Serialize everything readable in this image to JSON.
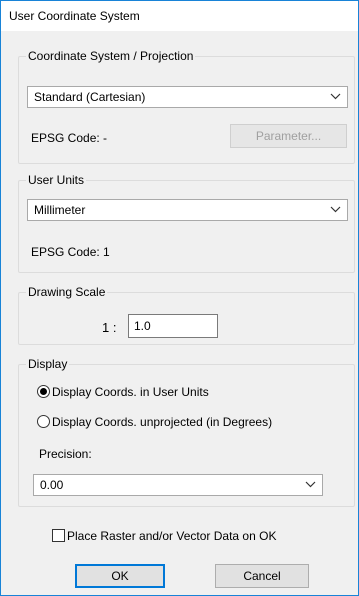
{
  "window": {
    "title": "User Coordinate System"
  },
  "coord_system": {
    "legend": "Coordinate System / Projection",
    "selected": "Standard (Cartesian)",
    "epsg_label": "EPSG Code: -",
    "parameter_button": "Parameter..."
  },
  "user_units": {
    "legend": "User Units",
    "selected": "Millimeter",
    "epsg_label": "EPSG Code: 1"
  },
  "drawing_scale": {
    "legend": "Drawing Scale",
    "prefix": "1 :",
    "value": "1.0"
  },
  "display": {
    "legend": "Display",
    "radio_user_units": "Display Coords. in User Units",
    "radio_unprojected": "Display Coords. unprojected (in Degrees)",
    "selected_radio": "user_units",
    "precision_label": "Precision:",
    "precision_value": "0.00"
  },
  "place_data_checkbox": {
    "label": "Place Raster and/or Vector Data on OK",
    "checked": false
  },
  "buttons": {
    "ok": "OK",
    "cancel": "Cancel"
  }
}
